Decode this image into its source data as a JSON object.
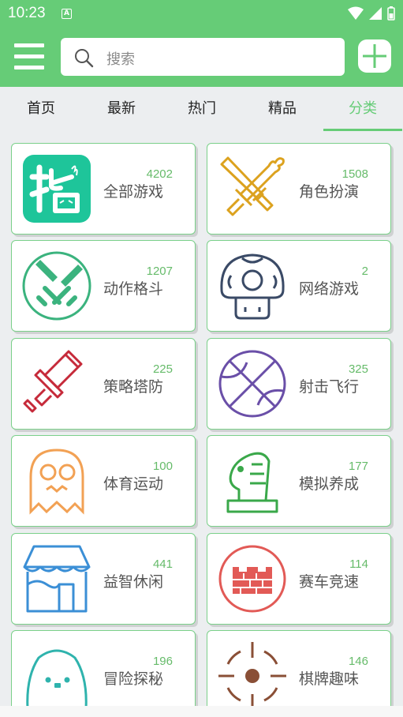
{
  "status": {
    "time": "10:23",
    "notification_icon": "A"
  },
  "appbar": {
    "menu_icon": "menu-icon",
    "search_placeholder": "搜索",
    "clover_icon": "clover-icon"
  },
  "tabs": [
    {
      "label": "首页",
      "active": false
    },
    {
      "label": "最新",
      "active": false
    },
    {
      "label": "热门",
      "active": false
    },
    {
      "label": "精品",
      "active": false
    },
    {
      "label": "分类",
      "active": true
    }
  ],
  "categories": [
    {
      "name": "全部游戏",
      "count": "4202",
      "icon": "app-logo-icon"
    },
    {
      "name": "角色扮演",
      "count": "1508",
      "icon": "crossed-swords-icon"
    },
    {
      "name": "动作格斗",
      "count": "1207",
      "icon": "crossed-swords-circle-icon"
    },
    {
      "name": "网络游戏",
      "count": "2",
      "icon": "mushroom-icon"
    },
    {
      "name": "策略塔防",
      "count": "225",
      "icon": "sword-icon"
    },
    {
      "name": "射击飞行",
      "count": "325",
      "icon": "ball-icon"
    },
    {
      "name": "体育运动",
      "count": "100",
      "icon": "ghost-icon"
    },
    {
      "name": "模拟养成",
      "count": "177",
      "icon": "chess-knight-icon"
    },
    {
      "name": "益智休闲",
      "count": "441",
      "icon": "shop-icon"
    },
    {
      "name": "赛车竞速",
      "count": "114",
      "icon": "castle-icon"
    },
    {
      "name": "冒险探秘",
      "count": "196",
      "icon": "blob-icon"
    },
    {
      "name": "棋牌趣味",
      "count": "146",
      "icon": "target-icon"
    }
  ],
  "colors": {
    "brand": "#66cc77",
    "count": "#66bb6a",
    "card_border": "#7bd08a"
  }
}
